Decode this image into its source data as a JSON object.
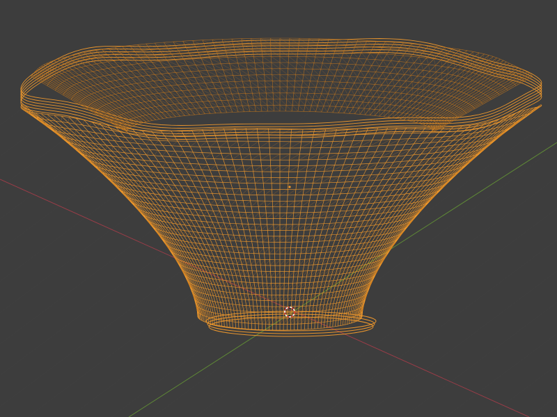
{
  "viewport": {
    "mode": "wireframe",
    "background_color": "#3d3d3d",
    "grid_color": "#474747",
    "x_axis_color": "#9a3d48",
    "y_axis_color": "#5f8a36",
    "wire_color": "#f29a2c",
    "wire_shade_color": "#c8781c",
    "cursor_colors": [
      "#e03a32",
      "#ffffff"
    ]
  },
  "objects": [
    {
      "name": "bowl",
      "kind": "mesh",
      "selected": true,
      "display": "wireframe"
    }
  ]
}
